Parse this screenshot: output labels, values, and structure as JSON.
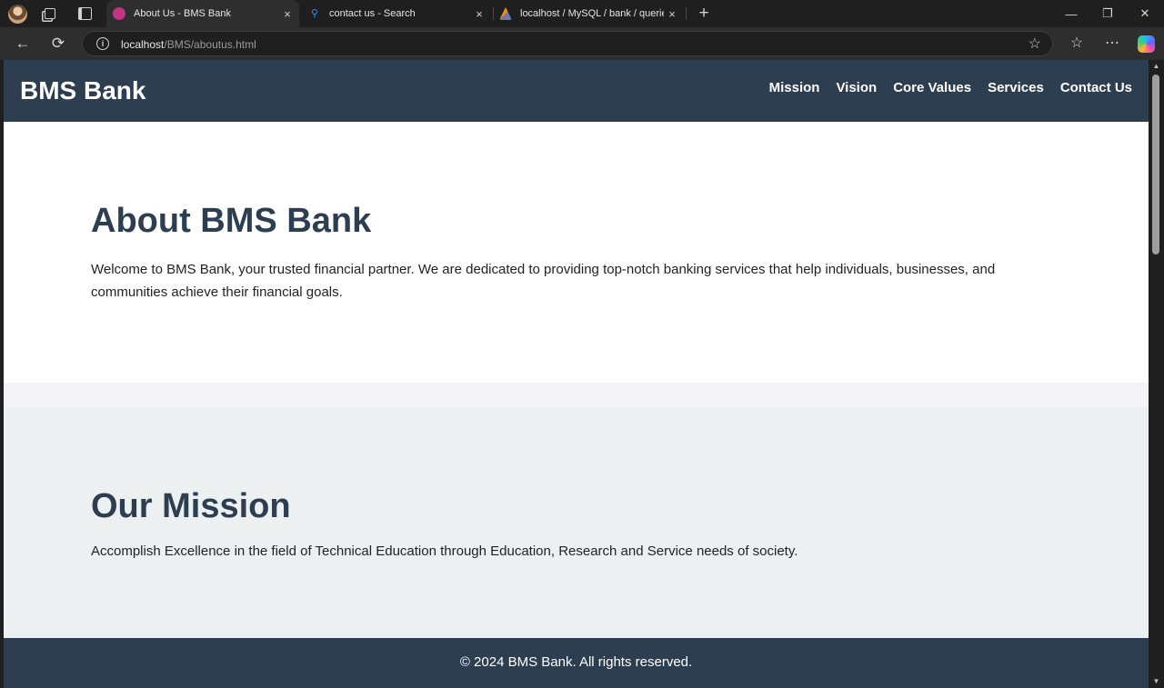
{
  "browser": {
    "tabs": [
      {
        "title": "About Us - BMS Bank",
        "active": true
      },
      {
        "title": "contact us - Search",
        "active": false
      },
      {
        "title": "localhost / MySQL / bank / queries",
        "active": false
      }
    ],
    "address": {
      "host": "localhost",
      "path": "/BMS/aboutus.html"
    },
    "icons": {
      "close": "×",
      "new_tab": "+",
      "minimize": "—",
      "restore": "❐",
      "window_close": "✕",
      "back": "←",
      "refresh": "⟳",
      "info": "i",
      "star": "☆",
      "favorites": "☆",
      "menu": "⋯",
      "search": "⚲",
      "scroll_up": "▲",
      "scroll_down": "▼"
    }
  },
  "site": {
    "brand": "BMS Bank",
    "nav": [
      "Mission",
      "Vision",
      "Core Values",
      "Services",
      "Contact Us"
    ],
    "about": {
      "title": "About BMS Bank",
      "text": "Welcome to BMS Bank, your trusted financial partner. We are dedicated to providing top-notch banking services that help individuals, businesses, and communities achieve their financial goals."
    },
    "mission": {
      "title": "Our Mission",
      "text": "Accomplish Excellence in the field of Technical Education through Education, Research and Service needs of society."
    },
    "footer": "© 2024 BMS Bank. All rights reserved.",
    "colors": {
      "header": "#2c3e50",
      "mission_bg": "#ecf0f1",
      "heading": "#2c3e50"
    }
  }
}
